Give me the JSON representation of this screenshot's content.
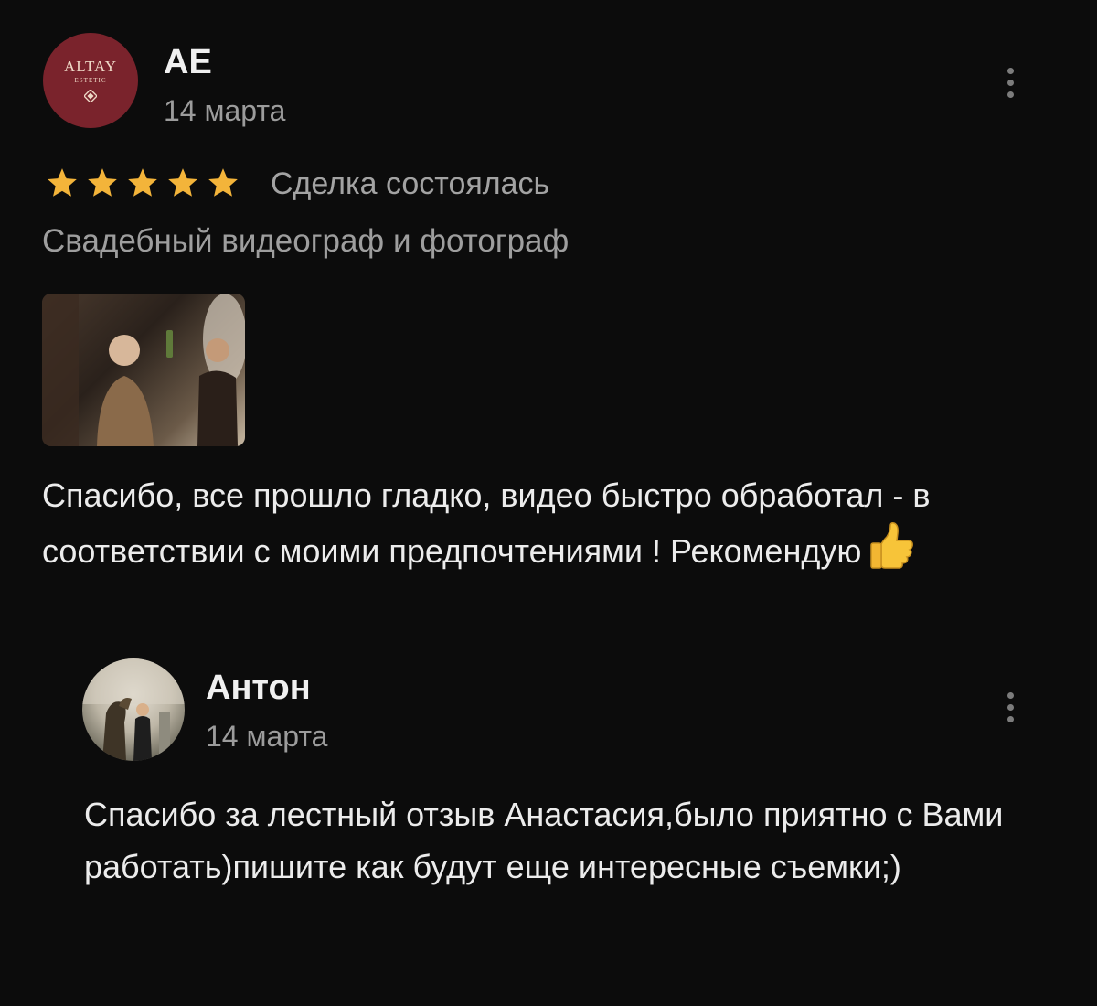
{
  "review": {
    "avatar": {
      "brand": "ALTAY",
      "subtitle": "ESTETIC"
    },
    "author": "AE",
    "date": "14 марта",
    "rating": 5,
    "deal_status": "Сделка состоялась",
    "category": "Свадебный видеограф и фотограф",
    "text": "Спасибо, все прошло гладко, видео быстро обработал - в соответствии с моими предпочтениями ! Рекомендую",
    "emoji": "thumbs-up-icon"
  },
  "reply": {
    "author": "Антон",
    "date": "14 марта",
    "text": "Спасибо за лестный отзыв Анастасия,было приятно с Вами работать)пишите как будут еще интересные съемки;)"
  },
  "colors": {
    "background": "#0c0c0c",
    "star": "#f3b43a",
    "avatar_bg": "#7a232c",
    "muted_text": "#9e9e9e"
  }
}
